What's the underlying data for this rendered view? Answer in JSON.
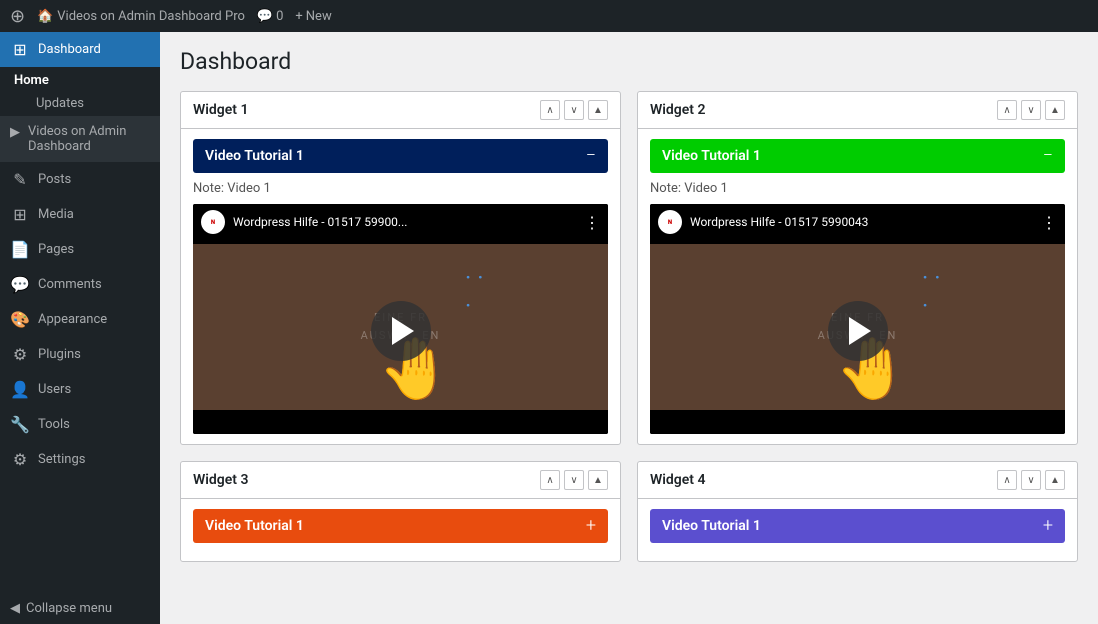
{
  "topbar": {
    "wp_icon": "⊕",
    "site_name": "Videos on Admin Dashboard Pro",
    "comments_label": "0",
    "new_label": "New"
  },
  "sidebar": {
    "dashboard_label": "Dashboard",
    "home_label": "Home",
    "updates_label": "Updates",
    "videos_label": "Videos on Admin Dashboard",
    "posts_label": "Posts",
    "media_label": "Media",
    "pages_label": "Pages",
    "comments_label": "Comments",
    "appearance_label": "Appearance",
    "plugins_label": "Plugins",
    "users_label": "Users",
    "tools_label": "Tools",
    "settings_label": "Settings",
    "collapse_label": "Collapse menu"
  },
  "main": {
    "page_title": "Dashboard",
    "widgets": [
      {
        "id": "widget1",
        "header": "Widget 1",
        "video_bar_label": "Video Tutorial 1",
        "video_bar_class": "dark-blue",
        "note": "Note: Video 1",
        "video_title": "Wordpress Hilfe - 01517 59900..."
      },
      {
        "id": "widget2",
        "header": "Widget 2",
        "video_bar_label": "Video Tutorial 1",
        "video_bar_class": "green",
        "note": "Note: Video 1",
        "video_title": "Wordpress Hilfe - 01517 5990043"
      },
      {
        "id": "widget3",
        "header": "Widget 3",
        "video_bar_label": "Video Tutorial 1",
        "video_bar_class": "orange-red",
        "collapsed": true
      },
      {
        "id": "widget4",
        "header": "Widget 4",
        "video_bar_label": "Video Tutorial 1",
        "video_bar_class": "purple",
        "collapsed": true
      }
    ]
  }
}
